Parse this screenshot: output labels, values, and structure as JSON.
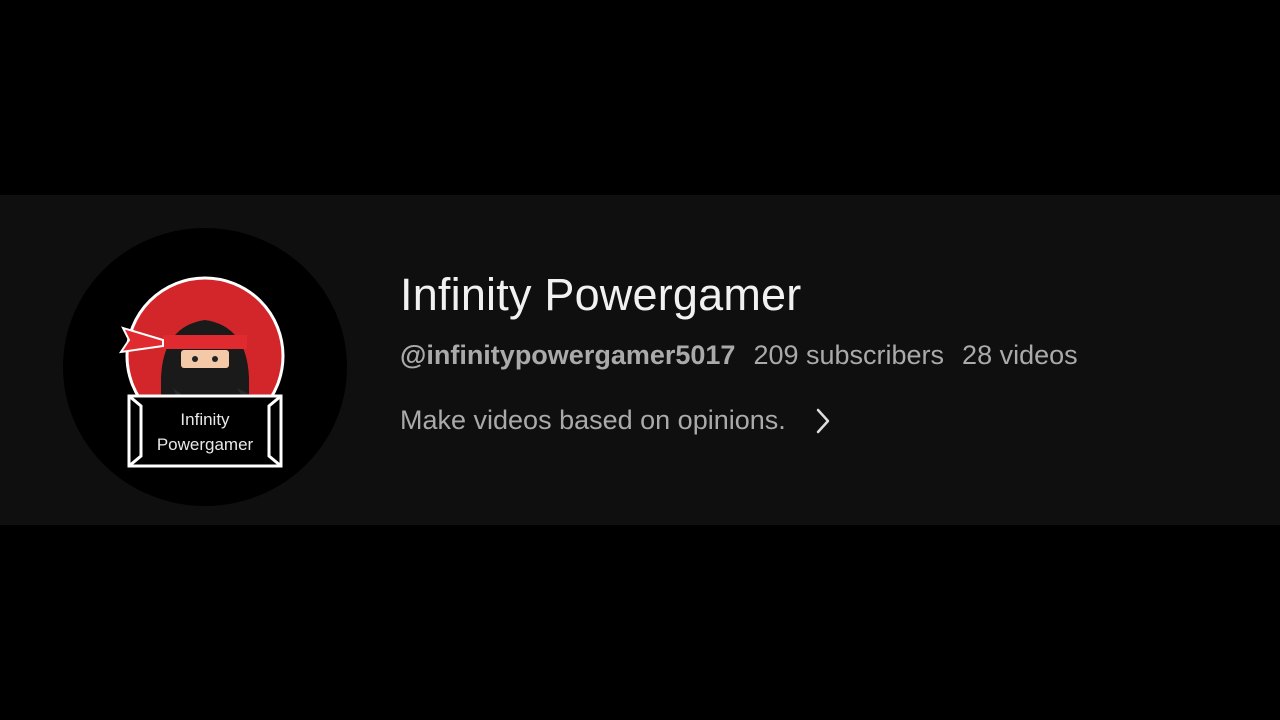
{
  "channel": {
    "name": "Infinity Powergamer",
    "handle": "@infinitypowergamer5017",
    "subscribers": "209 subscribers",
    "videos": "28 videos",
    "description": "Make videos based on opinions.",
    "avatar": {
      "icon": "ninja-logo-icon",
      "logo_text_line1": "Infinity",
      "logo_text_line2": "Powergamer"
    }
  },
  "icons": {
    "description_expand": "chevron-right-icon"
  },
  "colors": {
    "page_background": "#000000",
    "header_background": "#0f0f0f",
    "title_text": "#f1f1f1",
    "secondary_text": "#aaaaaa",
    "logo_red": "#d3262b"
  }
}
